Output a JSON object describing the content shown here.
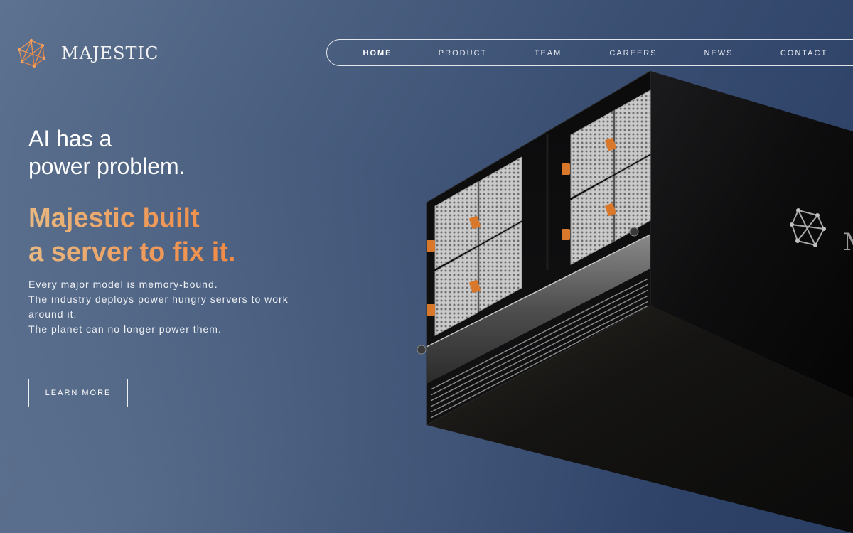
{
  "brand": {
    "name": "MAJESTIC",
    "icon": "geodesic-logo-icon"
  },
  "nav": {
    "items": [
      {
        "label": "HOME",
        "active": true
      },
      {
        "label": "PRODUCT",
        "active": false
      },
      {
        "label": "TEAM",
        "active": false
      },
      {
        "label": "CAREERS",
        "active": false
      },
      {
        "label": "NEWS",
        "active": false
      },
      {
        "label": "CONTACT",
        "active": false
      }
    ]
  },
  "hero": {
    "headline_line1": "AI has a",
    "headline_line2": "power problem.",
    "tagline_line1": "Majestic built",
    "tagline_line2": "a server to fix it.",
    "body": [
      "Every major model is memory-bound.",
      "The industry deploys power hungry servers to work around it.",
      "The planet can no longer power them."
    ],
    "cta_label": "LEARN MORE"
  },
  "server_badge": {
    "text": "M"
  },
  "colors": {
    "accent_start": "#e8b981",
    "accent_end": "#f08a45",
    "background": "#3a4f72",
    "connector": "#d9782a"
  }
}
